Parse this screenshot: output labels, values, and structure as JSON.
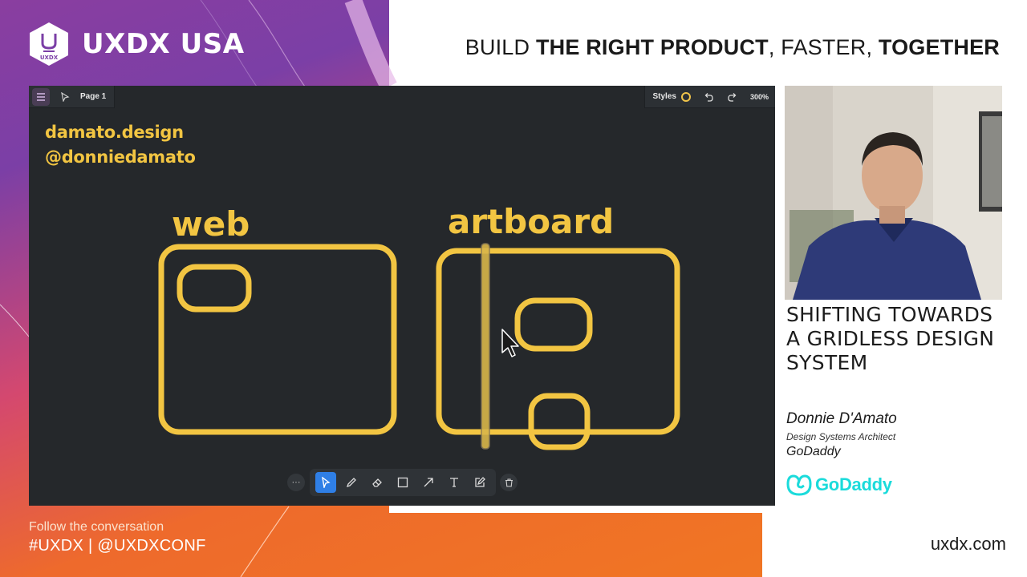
{
  "brand": {
    "name": "UXDX USA",
    "logo_mark": "UXDX"
  },
  "tagline": {
    "part1": "BUILD ",
    "part2": "THE RIGHT PRODUCT",
    "part3": ", FASTER, ",
    "part4": "TOGETHER"
  },
  "app": {
    "page_label": "Page 1",
    "styles_label": "Styles",
    "zoom": "300%",
    "menu_icon": "hamburger-icon",
    "toolbar_tools": [
      "select-icon",
      "pencil-icon",
      "eraser-icon",
      "rectangle-icon",
      "arrow-icon",
      "text-icon",
      "sticky-note-icon"
    ],
    "active_tool": "select-icon",
    "more_label": "···",
    "canvas": {
      "handle1": "damato.design",
      "handle2": "@donniedamato",
      "label_web": "web",
      "label_artboard": "artboard"
    },
    "accent_color": "#f2c542",
    "active_tool_color": "#2f7fe6"
  },
  "talk": {
    "title": "SHIFTING TOWARDS A GRIDLESS DESIGN SYSTEM",
    "speaker": "Donnie D'Amato",
    "role": "Design Systems Architect",
    "company": "GoDaddy",
    "company_logo_text": "GoDaddy"
  },
  "footer": {
    "follow": "Follow the conversation",
    "hashtags": "#UXDX | @UXDXCONF",
    "site": "uxdx.com"
  }
}
